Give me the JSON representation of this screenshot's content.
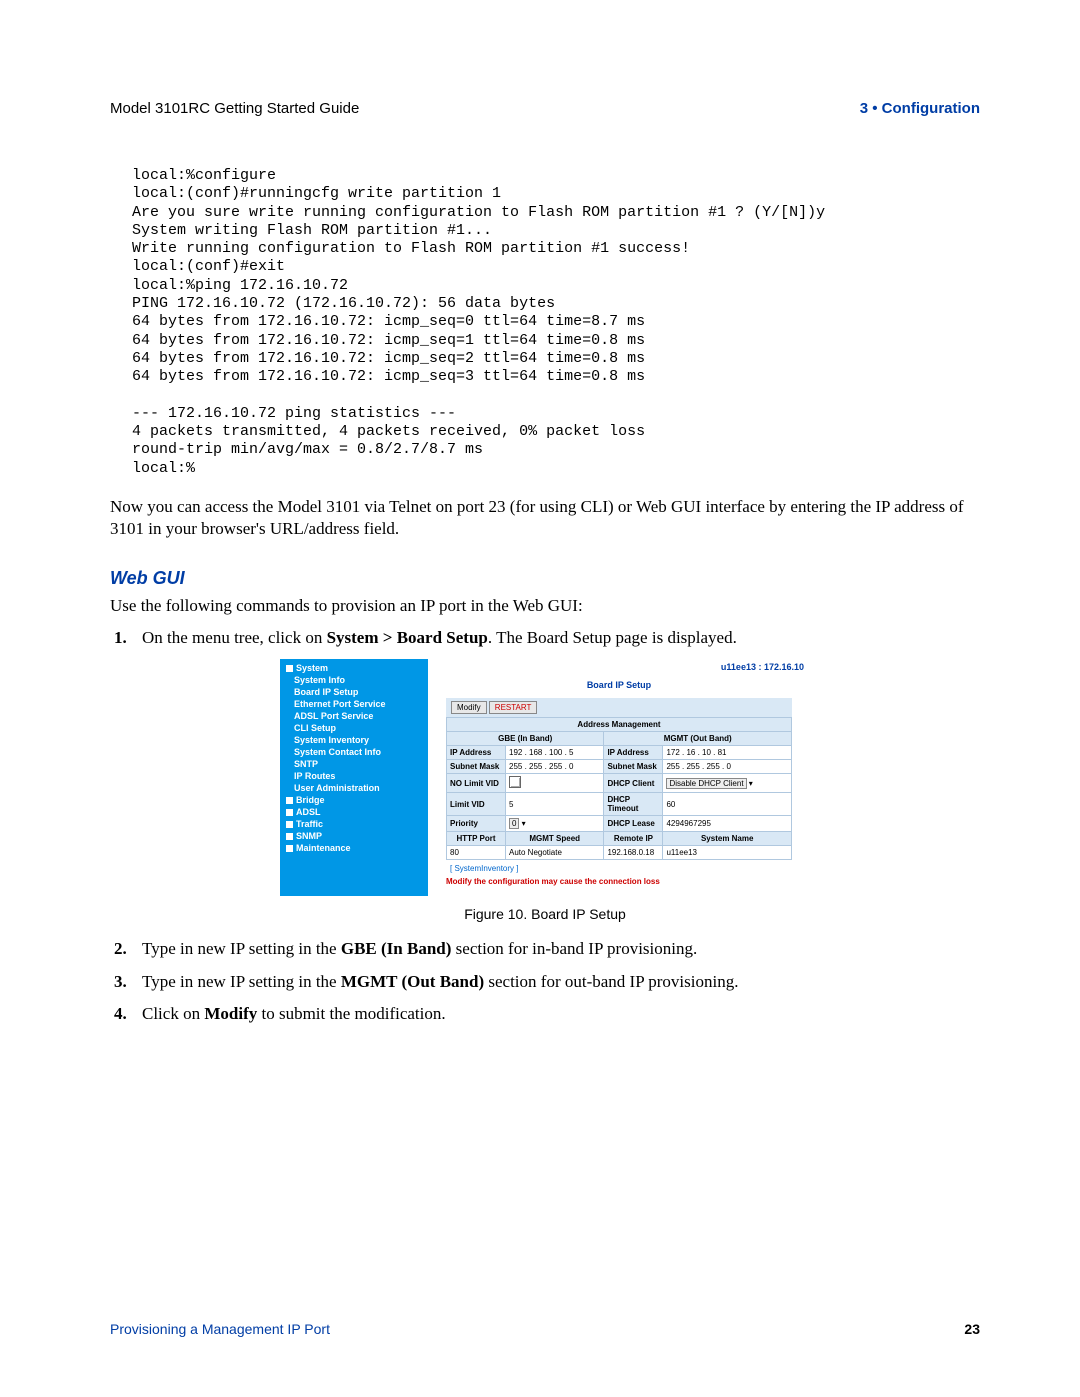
{
  "header": {
    "left": "Model 3101RC Getting Started Guide",
    "right": "3 • Configuration"
  },
  "code_block": "local:%configure\nlocal:(conf)#runningcfg write partition 1\nAre you sure write running configuration to Flash ROM partition #1 ? (Y/[N])y\nSystem writing Flash ROM partition #1...\nWrite running configuration to Flash ROM partition #1 success!\nlocal:(conf)#exit\nlocal:%ping 172.16.10.72\nPING 172.16.10.72 (172.16.10.72): 56 data bytes\n64 bytes from 172.16.10.72: icmp_seq=0 ttl=64 time=8.7 ms\n64 bytes from 172.16.10.72: icmp_seq=1 ttl=64 time=0.8 ms\n64 bytes from 172.16.10.72: icmp_seq=2 ttl=64 time=0.8 ms\n64 bytes from 172.16.10.72: icmp_seq=3 ttl=64 time=0.8 ms\n\n--- 172.16.10.72 ping statistics ---\n4 packets transmitted, 4 packets received, 0% packet loss\nround-trip min/avg/max = 0.8/2.7/8.7 ms\nlocal:%",
  "para1": "Now you can access the Model 3101 via Telnet on port 23 (for using CLI) or Web GUI interface by entering the IP address of 3101 in your browser's URL/address field.",
  "webgui_h": "Web GUI",
  "webgui_intro": "Use the following commands to provision an IP port in the Web GUI:",
  "step1": {
    "num": "1.",
    "pre": "On the menu tree, click on ",
    "bold": "System > Board Setup",
    "post": ". The Board Setup page is displayed."
  },
  "screenshot": {
    "menu": {
      "items": [
        {
          "lvl": 0,
          "label": "System"
        },
        {
          "lvl": 1,
          "label": "System Info"
        },
        {
          "lvl": 1,
          "label": "Board IP Setup"
        },
        {
          "lvl": 1,
          "label": "Ethernet Port Service"
        },
        {
          "lvl": 1,
          "label": "ADSL Port Service"
        },
        {
          "lvl": 1,
          "label": "CLI Setup"
        },
        {
          "lvl": 1,
          "label": "System Inventory"
        },
        {
          "lvl": 1,
          "label": "System Contact Info"
        },
        {
          "lvl": 1,
          "label": "SNTP"
        },
        {
          "lvl": 1,
          "label": "IP Routes"
        },
        {
          "lvl": 1,
          "label": "User Administration"
        },
        {
          "lvl": 0,
          "label": "Bridge"
        },
        {
          "lvl": 0,
          "label": "ADSL"
        },
        {
          "lvl": 0,
          "label": "Traffic"
        },
        {
          "lvl": 0,
          "label": "SNMP"
        },
        {
          "lvl": 0,
          "label": "Maintenance"
        }
      ]
    },
    "topright": "u11ee13 : 172.16.10",
    "title": "Board IP Setup",
    "buttons": {
      "modify": "Modify",
      "restart": "RESTART"
    },
    "addr_header": "Address Management",
    "cols": {
      "left": "GBE (In Band)",
      "right": "MGMT (Out Band)"
    },
    "rows": {
      "ip_label": "IP Address",
      "ip_in": "192 . 168 . 100 . 5",
      "ip_out": "172 . 16 . 10 . 81",
      "mask_label": "Subnet Mask",
      "mask_in": "255 . 255 . 255 . 0",
      "mask_out": "255 . 255 . 255 . 0",
      "nolimit_label": "NO Limit VID",
      "dhcp_client_label": "DHCP Client",
      "dhcp_client_val": "Disable DHCP Client",
      "limitvid_label": "Limit VID",
      "limitvid_val": "5",
      "dhcp_to_label": "DHCP Timeout",
      "dhcp_to_val": "60",
      "priority_label": "Priority",
      "priority_val": "0",
      "dhcp_lease_label": "DHCP Lease",
      "dhcp_lease_val": "4294967295",
      "http_label": "HTTP Port",
      "mgmt_speed_label": "MGMT Speed",
      "remote_label": "Remote IP",
      "sysname_label": "System Name",
      "http_val": "80",
      "mgmt_speed_val": "Auto Negotiate",
      "remote_val": "192.168.0.18",
      "sysname_val": "u11ee13"
    },
    "link": "[ SystemInventory ]",
    "warn": "Modify the configuration may cause the connection loss"
  },
  "figcaption": "Figure 10. Board IP Setup",
  "step2": {
    "num": "2.",
    "pre": "Type in new IP setting in the ",
    "bold": "GBE (In Band)",
    "post": " section for in-band IP provisioning."
  },
  "step3": {
    "num": "3.",
    "pre": "Type in new IP setting in the ",
    "bold": "MGMT (Out Band)",
    "post": " section for out-band IP provisioning."
  },
  "step4": {
    "num": "4.",
    "pre": "Click on ",
    "bold": "Modify",
    "post": " to submit the modification."
  },
  "footer": {
    "left": "Provisioning a Management IP Port",
    "right": "23"
  }
}
